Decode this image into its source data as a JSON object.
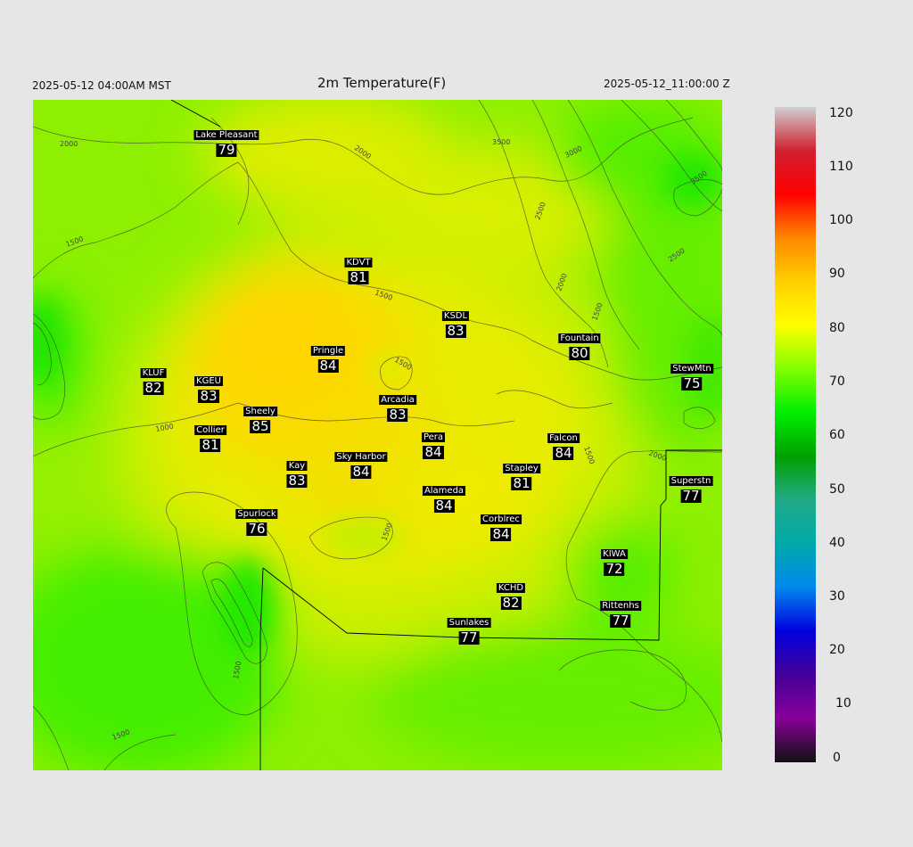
{
  "header": {
    "left": "2025-05-12 04:00AM MST",
    "title": "2m Temperature(F)",
    "right": "2025-05-12_11:00:00 Z"
  },
  "colorbar": {
    "labels": [
      "120",
      "110",
      "100",
      "90",
      "80",
      "70",
      "60",
      "50",
      "40",
      "30",
      "20",
      "10",
      "0"
    ],
    "stops": [
      "#cfcfcf",
      "#d02030",
      "#ff0000",
      "#ff8800",
      "#ffd000",
      "#ffff00",
      "#80ff00",
      "#00ee00",
      "#00a000",
      "#22aa88",
      "#00aaaa",
      "#0088ee",
      "#0000dd",
      "#440099",
      "#880099",
      "#111111"
    ]
  },
  "contours": {
    "labels": [
      "2000",
      "1500",
      "1000",
      "2000",
      "3500",
      "3000",
      "2500",
      "2000",
      "1500",
      "2500",
      "3500",
      "1500",
      "1500",
      "1500",
      "1500",
      "1500",
      "1500",
      "2000"
    ]
  },
  "stations": [
    {
      "id": "lake-pleasant",
      "name": "Lake Pleasant",
      "value": "79"
    },
    {
      "id": "kdvt",
      "name": "KDVT",
      "value": "81"
    },
    {
      "id": "ksdl",
      "name": "KSDL",
      "value": "83"
    },
    {
      "id": "fountain",
      "name": "Fountain",
      "value": "80"
    },
    {
      "id": "pringle",
      "name": "Pringle",
      "value": "84"
    },
    {
      "id": "kluf",
      "name": "KLUF",
      "value": "82"
    },
    {
      "id": "kgeu",
      "name": "KGEU",
      "value": "83"
    },
    {
      "id": "stewmtn",
      "name": "StewMtn",
      "value": "75"
    },
    {
      "id": "arcadia",
      "name": "Arcadia",
      "value": "83"
    },
    {
      "id": "sheely",
      "name": "Sheely",
      "value": "85"
    },
    {
      "id": "collier",
      "name": "Collier",
      "value": "81"
    },
    {
      "id": "pera",
      "name": "Pera",
      "value": "84"
    },
    {
      "id": "falcon",
      "name": "Falcon",
      "value": "84"
    },
    {
      "id": "sky-harbor",
      "name": "Sky Harbor",
      "value": "84"
    },
    {
      "id": "kay",
      "name": "Kay",
      "value": "83"
    },
    {
      "id": "stapley",
      "name": "Stapley",
      "value": "81"
    },
    {
      "id": "superstn",
      "name": "Superstn",
      "value": "77"
    },
    {
      "id": "alameda",
      "name": "Alameda",
      "value": "84"
    },
    {
      "id": "spurlock",
      "name": "Spurlock",
      "value": "76"
    },
    {
      "id": "corblrec",
      "name": "Corblrec",
      "value": "84"
    },
    {
      "id": "kiwa",
      "name": "KIWA",
      "value": "72"
    },
    {
      "id": "kchd",
      "name": "KCHD",
      "value": "82"
    },
    {
      "id": "rittenhs",
      "name": "Rittenhs",
      "value": "77"
    },
    {
      "id": "sunlakes",
      "name": "Sunlakes",
      "value": "77"
    }
  ]
}
